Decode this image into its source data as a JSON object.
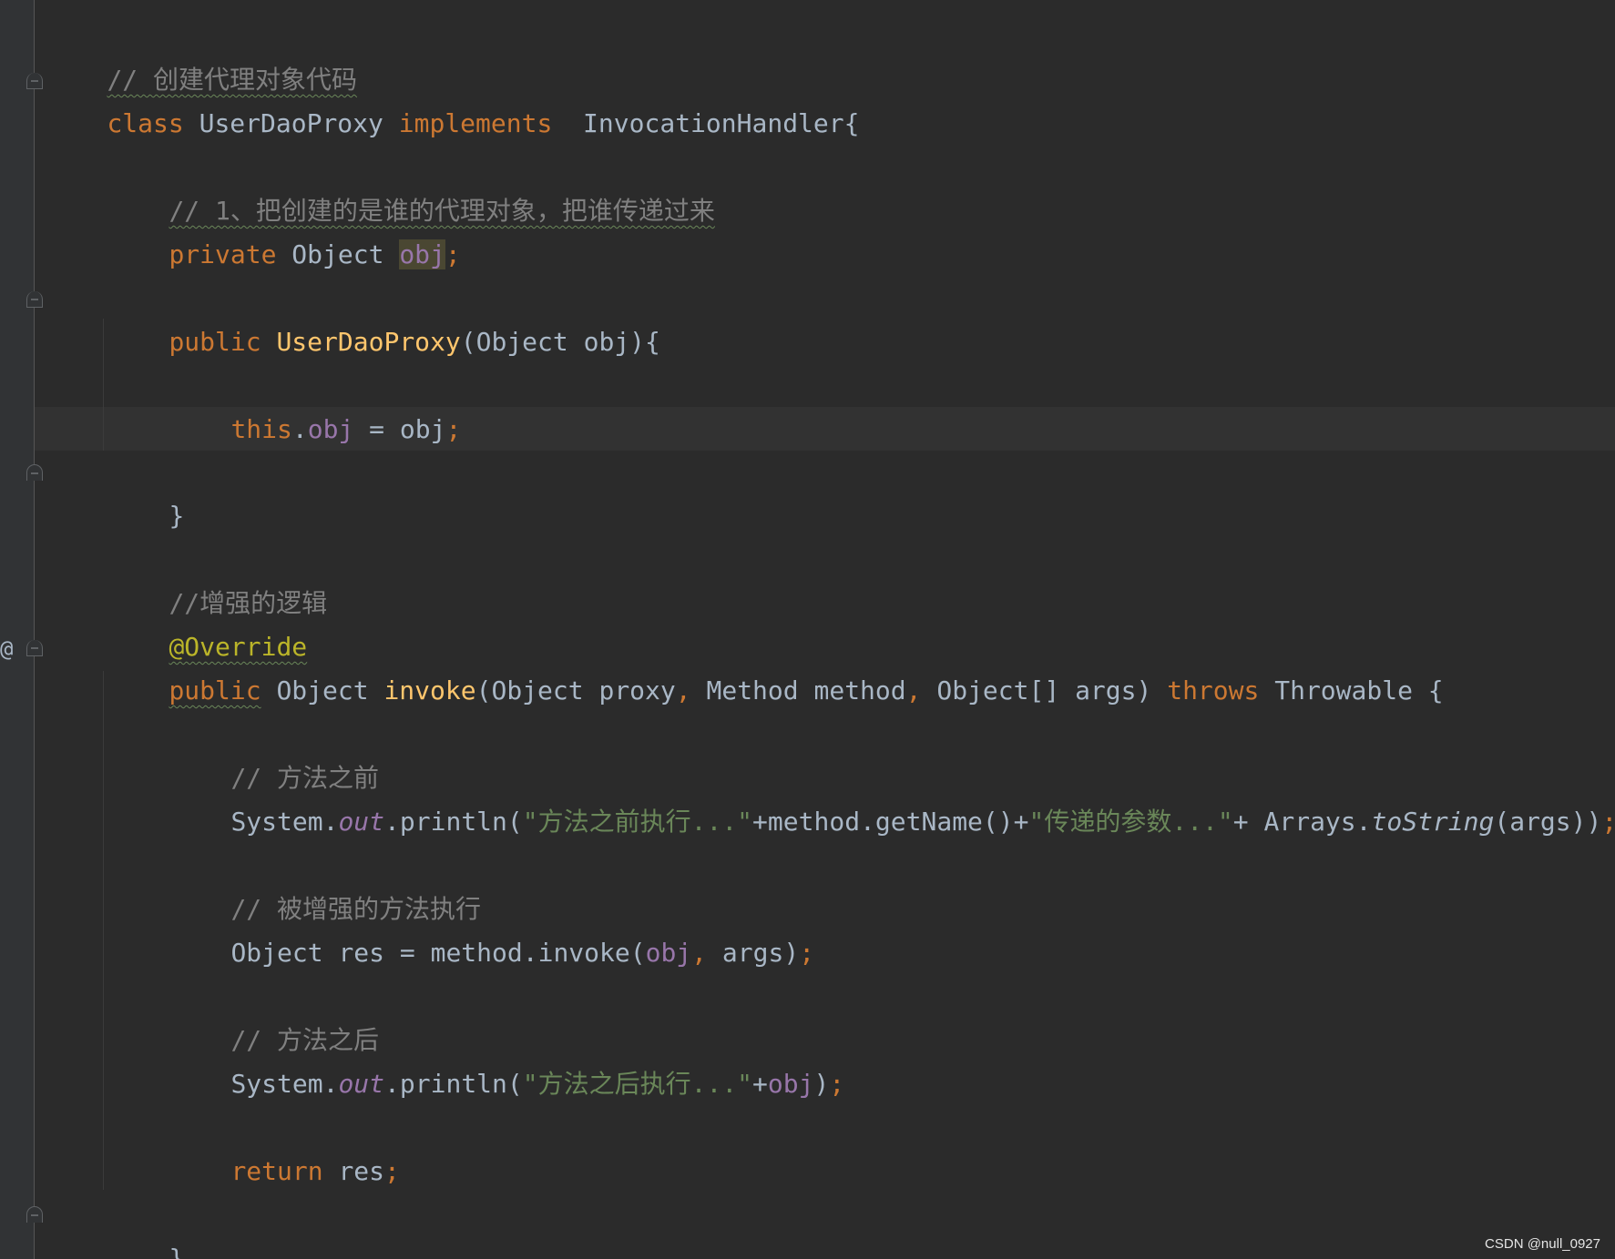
{
  "editor": {
    "theme_colors": {
      "background": "#2b2b2b",
      "keyword": "#cc7832",
      "comment": "#808080",
      "function": "#ffc66d",
      "field": "#9876aa",
      "string": "#6a8759",
      "annotation": "#bbb529",
      "default": "#a9b7c6"
    },
    "gutter_marker": "@",
    "lines": {
      "l1": {
        "comment": "// 创建代理对象代码"
      },
      "l2": {
        "kw_class": "class",
        "class_name": " UserDaoProxy ",
        "kw_implements": "implements",
        "interface": "  InvocationHandler{"
      },
      "l3": {
        "comment": "// 1、把创建的是谁的代理对象，把谁传递过来"
      },
      "l4": {
        "kw_private": "private",
        "type": " Object ",
        "field": "obj",
        "semi": ";"
      },
      "l5": {
        "kw_public": "public",
        "sp": " ",
        "ctor": "UserDaoProxy",
        "params": "(Object obj){"
      },
      "l6": {
        "kw_this": "this",
        "dot": ".",
        "field": "obj",
        "assign": " = obj",
        "semi": ";"
      },
      "l7": {
        "brace": "}"
      },
      "l8": {
        "comment": "//增强的逻辑"
      },
      "l9": {
        "annotation": "@Override"
      },
      "l10": {
        "kw_public": "public",
        "type": " Object ",
        "method": "invoke",
        "p1": "(Object proxy",
        "c1": ",",
        "p2": " Method method",
        "c2": ",",
        "p3": " Object[] args) ",
        "kw_throws": "throws",
        "rest": " Throwable {"
      },
      "l11": {
        "comment": "// 方法之前"
      },
      "l12": {
        "sys": "System.",
        "out": "out",
        "call": ".println(",
        "s1": "\"方法之前执行...\"",
        "mid": "+method.getName()+",
        "s2": "\"传递的参数...\"",
        "plus": "+ Arrays.",
        "tostring": "toString",
        "end": "(args))",
        "semi": ";"
      },
      "l13": {
        "comment": "// 被增强的方法执行"
      },
      "l14": {
        "pre": "Object res = method.invoke(",
        "field": "obj",
        "comma": ",",
        "post": " args)",
        "semi": ";"
      },
      "l15": {
        "comment": "// 方法之后"
      },
      "l16": {
        "sys": "System.",
        "out": "out",
        "call": ".println(",
        "s1": "\"方法之后执行...\"",
        "plus": "+",
        "field": "obj",
        "close": ")",
        "semi": ";"
      },
      "l17": {
        "kw_return": "return",
        "rest": " res",
        "semi": ";"
      },
      "l18": {
        "brace": "}"
      }
    }
  },
  "watermark": "CSDN @null_0927"
}
